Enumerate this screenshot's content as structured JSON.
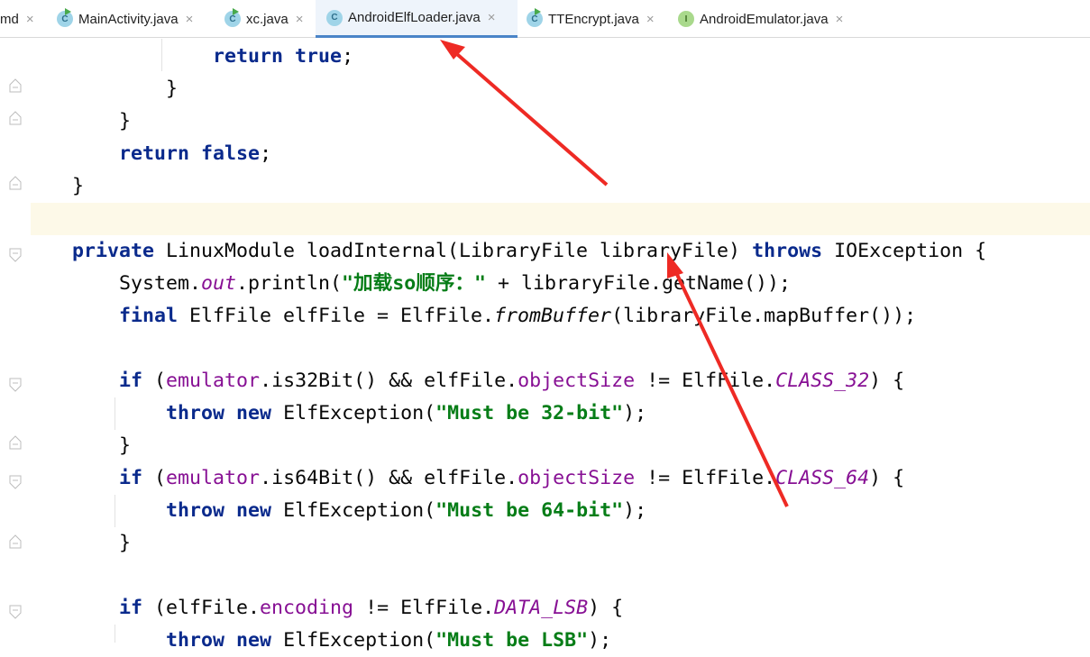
{
  "tabs": [
    {
      "label": "md",
      "kind": "none",
      "active": false
    },
    {
      "label": "MainActivity.java",
      "kind": "class",
      "active": false
    },
    {
      "label": "xc.java",
      "kind": "class",
      "active": false
    },
    {
      "label": "AndroidElfLoader.java",
      "kind": "class",
      "active": true
    },
    {
      "label": "TTEncrypt.java",
      "kind": "class",
      "active": false
    },
    {
      "label": "AndroidEmulator.java",
      "kind": "interface",
      "active": false
    }
  ],
  "tab_icon_letters": {
    "class": "C",
    "interface": "I"
  },
  "close_glyph": "×",
  "code": [
    [
      {
        "t": "                "
      },
      {
        "t": "return",
        "c": "kw"
      },
      {
        "t": " "
      },
      {
        "t": "true",
        "c": "kw"
      },
      {
        "t": ";"
      }
    ],
    [
      {
        "t": "            }"
      }
    ],
    [
      {
        "t": "        }"
      }
    ],
    [
      {
        "t": "        "
      },
      {
        "t": "return",
        "c": "kw"
      },
      {
        "t": " "
      },
      {
        "t": "false",
        "c": "kw"
      },
      {
        "t": ";"
      }
    ],
    [
      {
        "t": "    }"
      }
    ],
    [],
    [
      {
        "t": "    "
      },
      {
        "t": "private",
        "c": "kw"
      },
      {
        "t": " LinuxModule loadInternal(LibraryFile libraryFile) "
      },
      {
        "t": "throws",
        "c": "kw"
      },
      {
        "t": " IOException {"
      }
    ],
    [
      {
        "t": "        System."
      },
      {
        "t": "out",
        "c": "st"
      },
      {
        "t": ".println("
      },
      {
        "t": "\"加载so顺序：\"",
        "c": "str"
      },
      {
        "t": " + libraryFile.getName());"
      }
    ],
    [
      {
        "t": "        "
      },
      {
        "t": "final",
        "c": "kw"
      },
      {
        "t": " ElfFile elfFile = ElfFile."
      },
      {
        "t": "fromBuffer",
        "c": "it"
      },
      {
        "t": "(libraryFile.mapBuffer());"
      }
    ],
    [],
    [
      {
        "t": "        "
      },
      {
        "t": "if",
        "c": "kw"
      },
      {
        "t": " ("
      },
      {
        "t": "emulator",
        "c": "fld"
      },
      {
        "t": ".is32Bit() && elfFile."
      },
      {
        "t": "objectSize",
        "c": "fld"
      },
      {
        "t": " != ElfFile."
      },
      {
        "t": "CLASS_32",
        "c": "st"
      },
      {
        "t": ") {"
      }
    ],
    [
      {
        "t": "            "
      },
      {
        "t": "throw",
        "c": "kw"
      },
      {
        "t": " "
      },
      {
        "t": "new",
        "c": "kw"
      },
      {
        "t": " ElfException("
      },
      {
        "t": "\"Must be 32-bit\"",
        "c": "str"
      },
      {
        "t": ");"
      }
    ],
    [
      {
        "t": "        }"
      }
    ],
    [
      {
        "t": "        "
      },
      {
        "t": "if",
        "c": "kw"
      },
      {
        "t": " ("
      },
      {
        "t": "emulator",
        "c": "fld"
      },
      {
        "t": ".is64Bit() && elfFile."
      },
      {
        "t": "objectSize",
        "c": "fld"
      },
      {
        "t": " != ElfFile."
      },
      {
        "t": "CLASS_64",
        "c": "st"
      },
      {
        "t": ") {"
      }
    ],
    [
      {
        "t": "            "
      },
      {
        "t": "throw",
        "c": "kw"
      },
      {
        "t": " "
      },
      {
        "t": "new",
        "c": "kw"
      },
      {
        "t": " ElfException("
      },
      {
        "t": "\"Must be 64-bit\"",
        "c": "str"
      },
      {
        "t": ");"
      }
    ],
    [
      {
        "t": "        }"
      }
    ],
    [],
    [
      {
        "t": "        "
      },
      {
        "t": "if",
        "c": "kw"
      },
      {
        "t": " (elfFile."
      },
      {
        "t": "encoding",
        "c": "fld"
      },
      {
        "t": " != ElfFile."
      },
      {
        "t": "DATA_LSB",
        "c": "st"
      },
      {
        "t": ") {"
      }
    ],
    [
      {
        "t": "            "
      },
      {
        "t": "throw",
        "c": "kw"
      },
      {
        "t": " "
      },
      {
        "t": "new",
        "c": "kw"
      },
      {
        "t": " ElfException("
      },
      {
        "t": "\"Must be LSB\"",
        "c": "str"
      },
      {
        "t": ");"
      }
    ]
  ],
  "colors": {
    "keyword": "#0a2a8c",
    "string": "#067d17",
    "field": "#871094",
    "caret_line": "#fdf9e8",
    "active_tab_underline": "#4a84c8",
    "annotation_arrow": "#ee2a24"
  }
}
